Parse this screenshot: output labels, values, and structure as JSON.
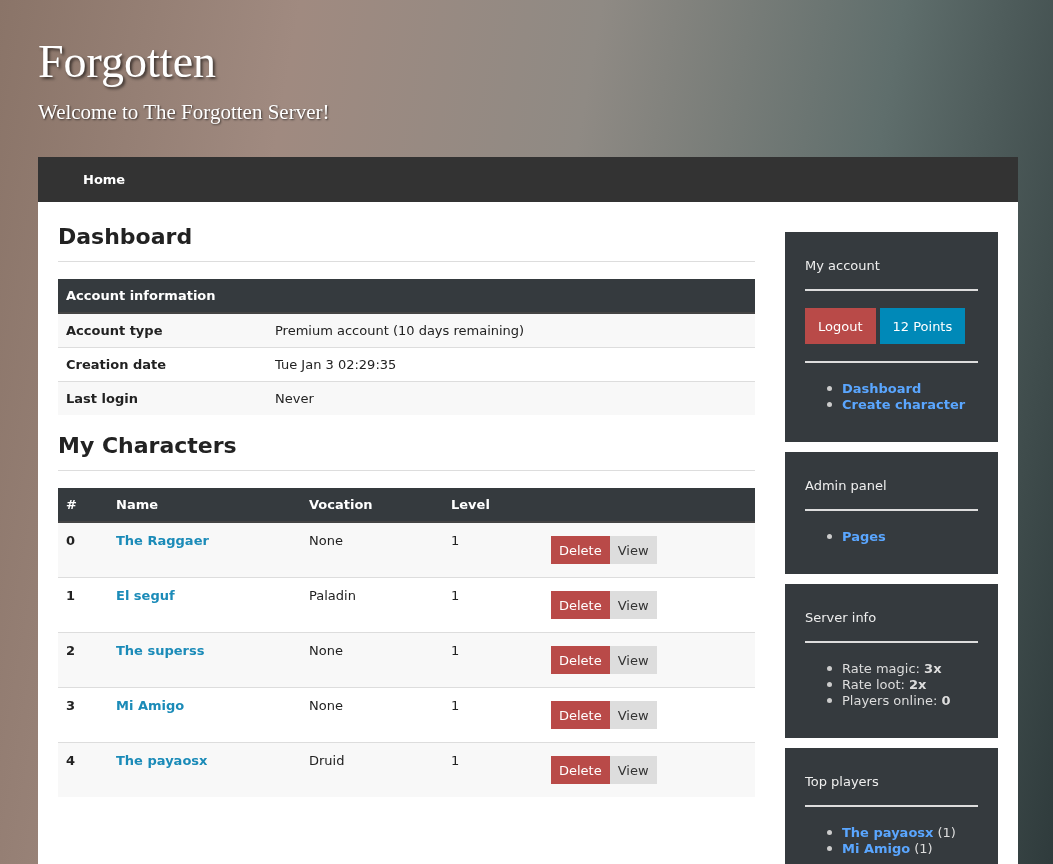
{
  "header": {
    "title": "Forgotten",
    "subtitle": "Welcome to The Forgotten Server!"
  },
  "nav": [
    {
      "label": "Home"
    }
  ],
  "main": {
    "title": "Dashboard",
    "account_table": {
      "heading": "Account information",
      "rows": [
        {
          "label": "Account type",
          "value": "Premium account (10 days remaining)"
        },
        {
          "label": "Creation date",
          "value": "Tue Jan 3 02:29:35"
        },
        {
          "label": "Last login",
          "value": "Never"
        }
      ]
    },
    "characters_title": "My Characters",
    "characters": {
      "columns": [
        "#",
        "Name",
        "Vocation",
        "Level"
      ],
      "rows": [
        {
          "index": "0",
          "name": "The Raggaer",
          "vocation": "None",
          "level": "1",
          "actions": [
            "Delete",
            "View"
          ]
        },
        {
          "index": "1",
          "name": "El seguf",
          "vocation": "Paladin",
          "level": "1",
          "actions": [
            "Delete",
            "View"
          ]
        },
        {
          "index": "2",
          "name": "The superss",
          "vocation": "None",
          "level": "1",
          "actions": [
            "Delete",
            "View"
          ]
        },
        {
          "index": "3",
          "name": "Mi Amigo",
          "vocation": "None",
          "level": "1",
          "actions": [
            "Delete",
            "View"
          ]
        },
        {
          "index": "4",
          "name": "The payaosx",
          "vocation": "Druid",
          "level": "1",
          "actions": [
            "Delete",
            "View"
          ]
        }
      ]
    }
  },
  "sidebar": [
    {
      "kind": "account",
      "title": "My account",
      "buttons": [
        {
          "label": "Logout",
          "kind": "danger"
        },
        {
          "label": "12 Points",
          "kind": "info"
        }
      ],
      "links": [
        "Dashboard",
        "Create character"
      ]
    },
    {
      "kind": "links",
      "title": "Admin panel",
      "links": [
        "Pages"
      ]
    },
    {
      "kind": "info",
      "title": "Server info",
      "items": [
        "Rate magic: **3x**",
        "Rate loot: **2x**",
        "Players online: **0**"
      ]
    },
    {
      "kind": "players",
      "title": "Top players",
      "players": [
        {
          "name": "The payaosx",
          "score": "(1)"
        },
        {
          "name": "Mi Amigo",
          "score": "(1)"
        }
      ]
    }
  ]
}
